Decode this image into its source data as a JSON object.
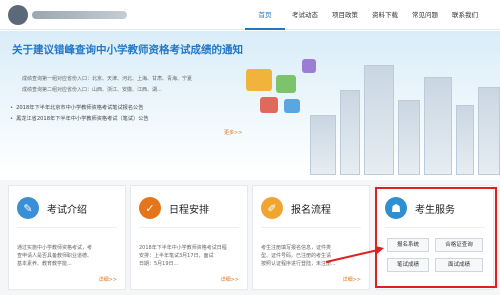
{
  "header": {
    "site_name": "",
    "nav": [
      "首页",
      "考试动态",
      "项目政策",
      "资料下载",
      "常见问题",
      "联系我们"
    ]
  },
  "banner": {
    "title": "关于建议错峰查询中小学教师资格考试成绩的通知",
    "lines": [
      "成绩查询第一组对应省份入口：北京、天津、河北、上海、甘肃、青海、宁夏",
      "成绩查询第二组对应省份入口：山西、浙江、安徽、江西、湖..."
    ],
    "news": [
      "2018年下半年北京市中小学教师资格考试笔试报名公告",
      "黑龙江省2018年下半年中小学教师资格考试（笔试）公告"
    ],
    "more": "更多>>"
  },
  "cards": [
    {
      "title": "考试介绍",
      "lines": [
        "通过实施中小学教师资格考试，考",
        "查申请人是否具备教师职业道德、",
        "基本素养、教育教学能..."
      ],
      "link": "详细>>"
    },
    {
      "title": "日程安排",
      "lines": [
        "2018年下半年中小学教师资格考试日程",
        "安排：上半年笔试3月17日，面试",
        "日期：5月19日..."
      ],
      "link": "详细>>"
    },
    {
      "title": "报名流程",
      "lines": [
        "考生注册填写报名信息，证件类",
        "型、证件号码。已注册的考生请",
        "按照认证程序进行登陆，未注册..."
      ],
      "link": "详细>>"
    },
    {
      "title": "考生服务",
      "buttons": [
        "报名系统",
        "合格证查询",
        "笔试成绩",
        "面试成绩"
      ]
    }
  ],
  "colors": {
    "accent": "#2378c7",
    "link": "#e4751c",
    "highlight": "#e02020"
  }
}
